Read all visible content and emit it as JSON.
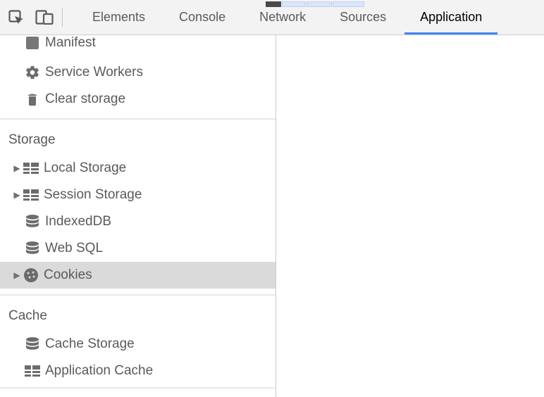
{
  "tabs": {
    "elements": "Elements",
    "console": "Console",
    "network": "Network",
    "sources": "Sources",
    "application": "Application"
  },
  "application": {
    "manifest": "Manifest",
    "service_workers": "Service Workers",
    "clear_storage": "Clear storage"
  },
  "storage": {
    "title": "Storage",
    "local_storage": "Local Storage",
    "session_storage": "Session Storage",
    "indexeddb": "IndexedDB",
    "websql": "Web SQL",
    "cookies": "Cookies"
  },
  "cache": {
    "title": "Cache",
    "cache_storage": "Cache Storage",
    "application_cache": "Application Cache"
  }
}
